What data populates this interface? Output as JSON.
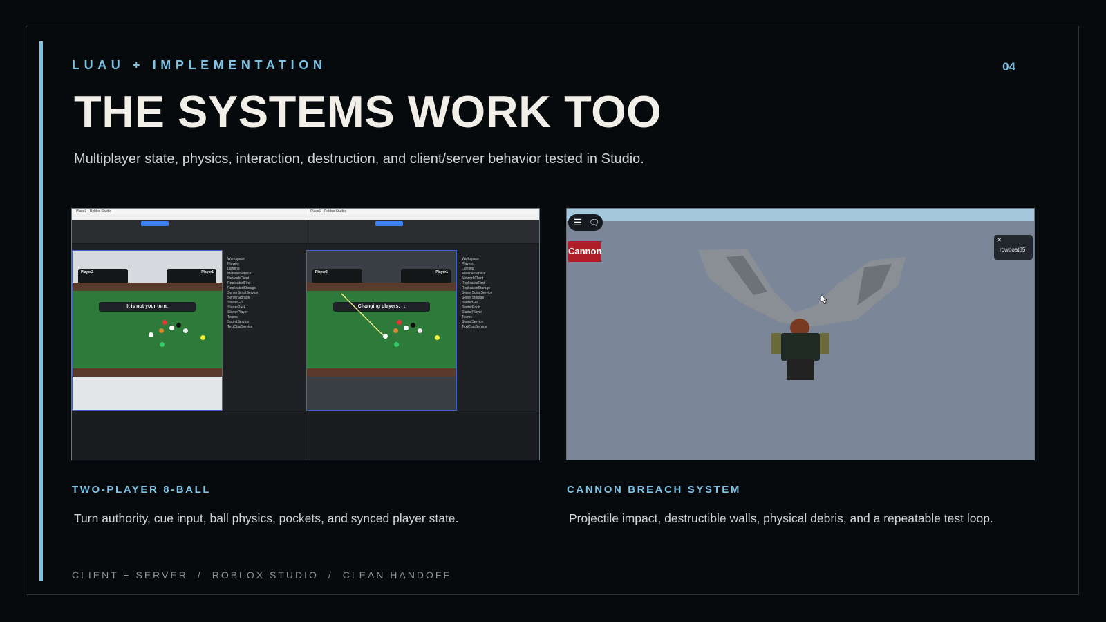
{
  "eyebrow": "LUAU + IMPLEMENTATION",
  "page_number": "04",
  "title": "THE SYSTEMS WORK TOO",
  "subtitle": "Multiplayer state, physics, interaction, destruction, and client/server behavior tested in Studio.",
  "left_card": {
    "heading": "TWO-PLAYER 8-BALL",
    "description": "Turn authority, cue input, ball physics, pockets, and synced player state.",
    "studio_a": {
      "window_title": "Place1 - Roblox Studio",
      "banner": "It is not your turn.",
      "hud_left_name": "Player2",
      "hud_right_name": "Player1"
    },
    "studio_b": {
      "window_title": "Place1 - Roblox Studio",
      "banner": "Changing players. . .",
      "hud_left_name": "Player2",
      "hud_right_name": "Player1"
    },
    "explorer_items": [
      "Workspace",
      "Players",
      "Lighting",
      "MaterialService",
      "NetworkClient",
      "ReplicatedFirst",
      "ReplicatedStorage",
      "ServerScriptService",
      "ServerStorage",
      "StarterGui",
      "StarterPack",
      "StarterPlayer",
      "Teams",
      "SoundService",
      "TextChatService"
    ]
  },
  "right_card": {
    "heading": "CANNON BREACH SYSTEM",
    "description": "Projectile impact, destructible walls, physical debris, and a repeatable test loop.",
    "game": {
      "cannon_button": "Cannon",
      "player_name": "rowboat85",
      "close_glyph": "✕"
    }
  },
  "footer": {
    "items": [
      "CLIENT + SERVER",
      "ROBLOX STUDIO",
      "CLEAN HANDOFF"
    ],
    "separator": "/"
  },
  "colors": {
    "background": "#070a0d",
    "accent": "#7cc3e6",
    "title": "#f2efe8",
    "body_text": "#cfd3d6",
    "footer_text": "#8c9399",
    "cannon_red": "#b01f28"
  }
}
